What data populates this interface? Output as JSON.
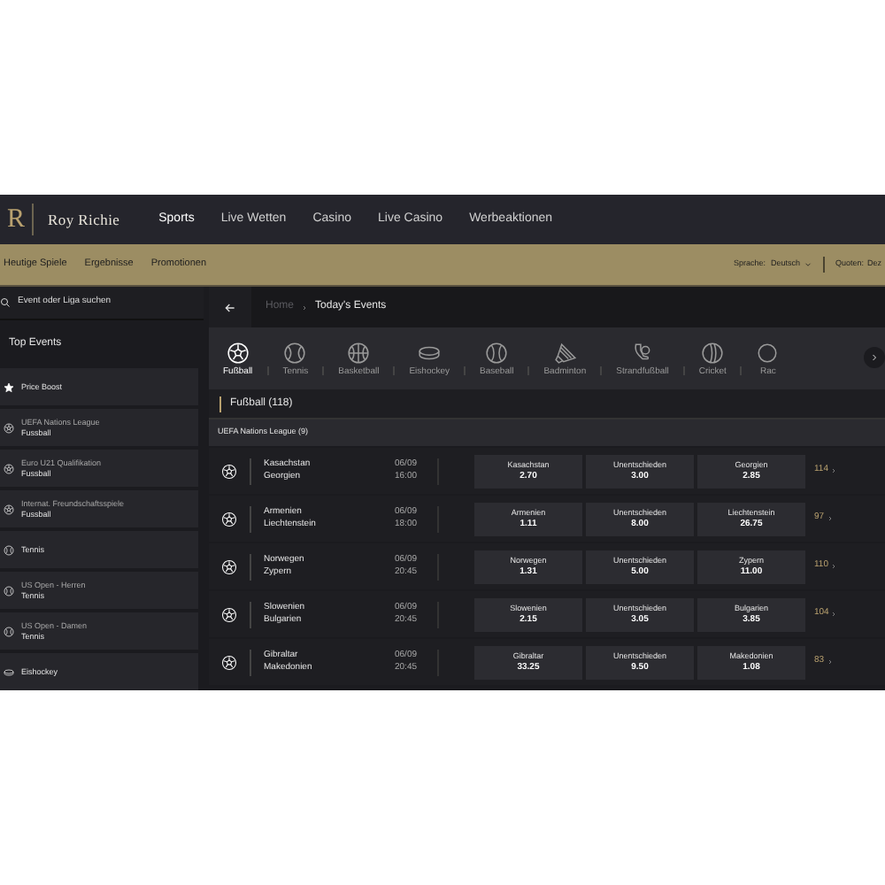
{
  "header": {
    "brand_mark": "R",
    "brand": "Roy Richie",
    "nav": [
      {
        "label": "Sports",
        "selected": true
      },
      {
        "label": "Live Wetten",
        "selected": false
      },
      {
        "label": "Casino",
        "selected": false
      },
      {
        "label": "Live Casino",
        "selected": false
      },
      {
        "label": "Werbeaktionen",
        "selected": false
      }
    ]
  },
  "subnav": {
    "links": [
      "Heutige Spiele",
      "Ergebnisse",
      "Promotionen"
    ],
    "language_label": "Sprache:",
    "language": "Deutsch",
    "odds_label": "Quoten:",
    "odds": "Dez"
  },
  "sidebar": {
    "search": {
      "placeholder": "Event oder Liga suchen"
    },
    "title": "Top Events",
    "items": [
      {
        "kind": "star",
        "title": "Price Boost"
      },
      {
        "kind": "soccer",
        "title": "UEFA Nations League",
        "subtitle": "Fussball"
      },
      {
        "kind": "soccer",
        "title": "Euro U21 Qualifikation",
        "subtitle": "Fussball"
      },
      {
        "kind": "soccer",
        "title": "Internat. Freundschaftsspiele",
        "subtitle": "Fussball"
      },
      {
        "kind": "tennis",
        "title": "Tennis"
      },
      {
        "kind": "tennis",
        "title": "US Open - Herren",
        "subtitle": "Tennis"
      },
      {
        "kind": "tennis",
        "title": "US Open - Damen",
        "subtitle": "Tennis"
      },
      {
        "kind": "hockey",
        "title": "Eishockey"
      }
    ]
  },
  "breadcrumb": [
    "Home",
    "Today's Events"
  ],
  "sports": [
    {
      "kind": "soccer",
      "label": "Fußball",
      "selected": true
    },
    {
      "kind": "tennis",
      "label": "Tennis",
      "selected": false
    },
    {
      "kind": "basketball",
      "label": "Basketball",
      "selected": false
    },
    {
      "kind": "hockey",
      "label": "Eishockey",
      "selected": false
    },
    {
      "kind": "baseball",
      "label": "Baseball",
      "selected": false
    },
    {
      "kind": "badminton",
      "label": "Badminton",
      "selected": false
    },
    {
      "kind": "beach",
      "label": "Strandfußball",
      "selected": false
    },
    {
      "kind": "cricket",
      "label": "Cricket",
      "selected": false
    },
    {
      "kind": "other",
      "label": "Rac",
      "selected": false
    }
  ],
  "section_title": "Fußball (118)",
  "league": "UEFA Nations League (9)",
  "matches": [
    {
      "home": "Kasachstan",
      "away": "Georgien",
      "date": "06/09",
      "time": "16:00",
      "odds": [
        {
          "label": "Kasachstan",
          "price": "2.70"
        },
        {
          "label": "Unentschieden",
          "price": "3.00"
        },
        {
          "label": "Georgien",
          "price": "2.85"
        }
      ],
      "more": "114"
    },
    {
      "home": "Armenien",
      "away": "Liechtenstein",
      "date": "06/09",
      "time": "18:00",
      "odds": [
        {
          "label": "Armenien",
          "price": "1.11"
        },
        {
          "label": "Unentschieden",
          "price": "8.00"
        },
        {
          "label": "Liechtenstein",
          "price": "26.75"
        }
      ],
      "more": "97"
    },
    {
      "home": "Norwegen",
      "away": "Zypern",
      "date": "06/09",
      "time": "20:45",
      "odds": [
        {
          "label": "Norwegen",
          "price": "1.31"
        },
        {
          "label": "Unentschieden",
          "price": "5.00"
        },
        {
          "label": "Zypern",
          "price": "11.00"
        }
      ],
      "more": "110"
    },
    {
      "home": "Slowenien",
      "away": "Bulgarien",
      "date": "06/09",
      "time": "20:45",
      "odds": [
        {
          "label": "Slowenien",
          "price": "2.15"
        },
        {
          "label": "Unentschieden",
          "price": "3.05"
        },
        {
          "label": "Bulgarien",
          "price": "3.85"
        }
      ],
      "more": "104"
    },
    {
      "home": "Gibraltar",
      "away": "Makedonien",
      "date": "06/09",
      "time": "20:45",
      "odds": [
        {
          "label": "Gibraltar",
          "price": "33.25"
        },
        {
          "label": "Unentschieden",
          "price": "9.50"
        },
        {
          "label": "Makedonien",
          "price": "1.08"
        }
      ],
      "more": "83"
    }
  ]
}
